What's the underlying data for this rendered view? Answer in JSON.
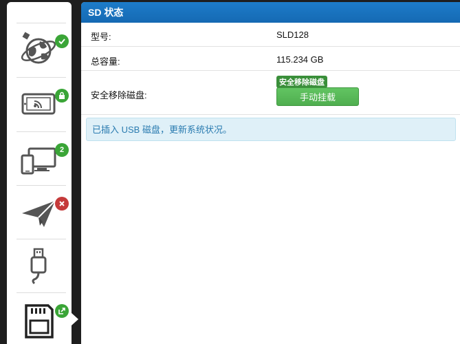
{
  "header": {
    "title": "SD 状态"
  },
  "rows": {
    "model": {
      "label": "型号:",
      "value": "SLD128"
    },
    "capacity": {
      "label": "总容量:",
      "value": "115.234 GB"
    },
    "eject": {
      "label": "安全移除磁盘:",
      "tag": "安全移除磁盘",
      "button": "手动挂载"
    }
  },
  "alert": {
    "text": "已插入 USB 磁盘，更新系统状况。"
  },
  "sidebar": {
    "items": [
      {
        "icon": "globe-satellite-icon",
        "badge_icon": "check-icon",
        "badge_color": "#3aa537"
      },
      {
        "icon": "tablet-wifi-icon",
        "badge_icon": "lock-icon",
        "badge_color": "#3aa537"
      },
      {
        "icon": "devices-icon",
        "badge_text": "2",
        "badge_color": "#3aa537"
      },
      {
        "icon": "paper-plane-icon",
        "badge_icon": "close-icon",
        "badge_color": "#c53a3a"
      },
      {
        "icon": "usb-icon"
      },
      {
        "icon": "sd-card-icon",
        "badge_icon": "export-icon",
        "badge_color": "#3aa537",
        "selected": true
      }
    ]
  }
}
